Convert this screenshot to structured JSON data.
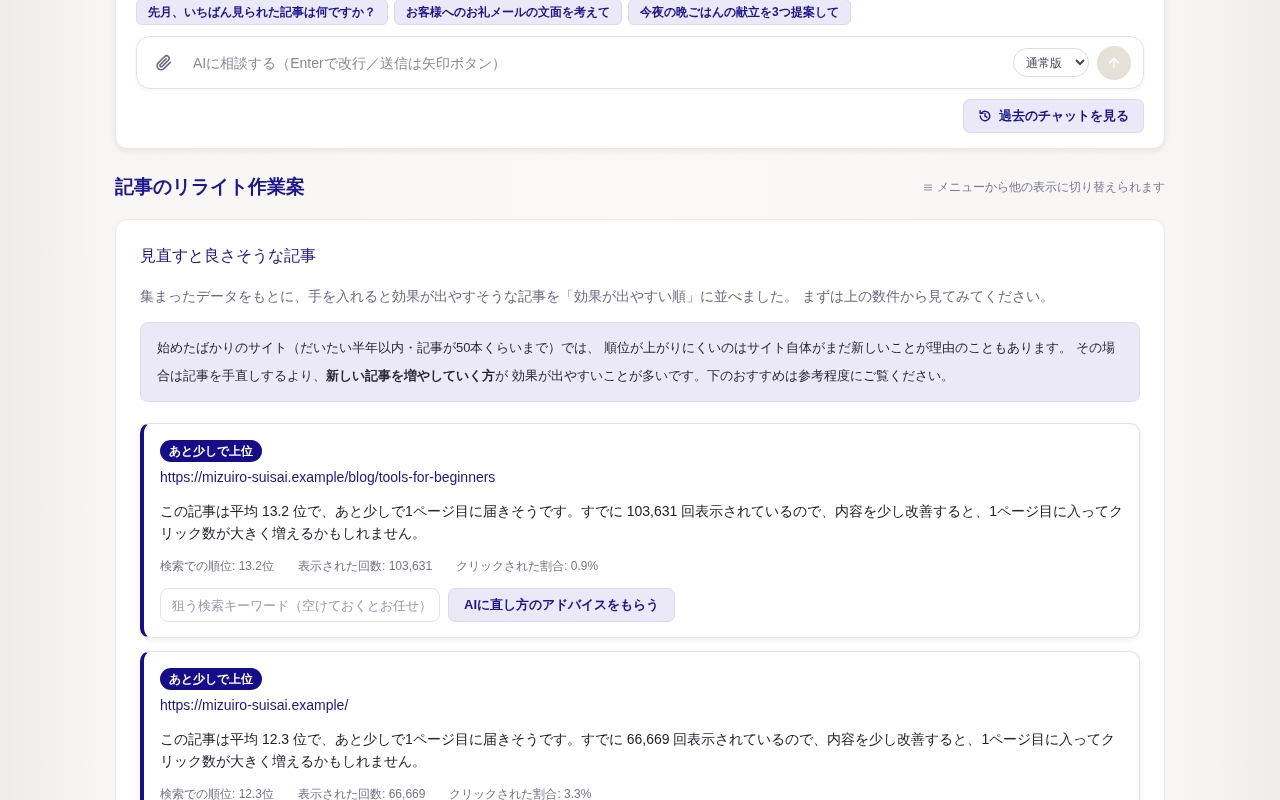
{
  "chat": {
    "suggestions": [
      "先月、いちばん見られた記事は何ですか？",
      "お客様へのお礼メールの文面を考えて",
      "今夜の晩ごはんの献立を3つ提案して"
    ],
    "input": {
      "placeholder": "AIに相談する（Enterで改行／送信は矢印ボタン）"
    },
    "mode": {
      "value": "通常版"
    },
    "send_button": {
      "disabled": true
    },
    "history_button": "過去のチャットを見る"
  },
  "section": {
    "title": "記事のリライト作業案",
    "hint": "メニューから他の表示に切り替えられます"
  },
  "panel": {
    "title": "見直すと良さそうな記事",
    "description": "集まったデータをもとに、手を入れると効果が出やすそうな記事を「効果が出やすい順」に並べました。 まずは上の数件から見てみてください。",
    "notice": "始めたばかりのサイト（だいたい半年以内・記事が50本くらいまで）では、 順位が上がりにくいのはサイト自体がまだ新しいことが理由のこともあります。 その場合は記事を手直しするより、**新しい記事を増やしていく方**が 効果が出やすいことが多いです。下のおすすめは参考程度にご覧ください。",
    "articles": [
      {
        "badge": "あと少しで上位",
        "url": "https://mizuiro-suisai.example/blog/tools-for-beginners",
        "summary": "この記事は平均 13.2 位で、あと少しで1ページ目に届きそうです。すでに 103,631 回表示されているので、内容を少し改善すると、1ページ目に入ってクリック数が大きく増えるかもしれません。",
        "metrics": [
          "検索での順位: 13.2位",
          "表示された回数: 103,631",
          "クリックされた割合: 0.9%"
        ],
        "keyword_field": {
          "placeholder": "狙う検索キーワード（空けておくとお任せ）"
        },
        "advice_button": "AIに直し方のアドバイスをもらう"
      },
      {
        "badge": "あと少しで上位",
        "url": "https://mizuiro-suisai.example/",
        "summary": "この記事は平均 12.3 位で、あと少しで1ページ目に届きそうです。すでに 66,669 回表示されているので、内容を少し改善すると、1ページ目に入ってクリック数が大きく増えるかもしれません。",
        "metrics": [
          "検索での順位: 12.3位",
          "表示された回数: 66,669",
          "クリックされた割合: 3.3%"
        ]
      }
    ]
  }
}
